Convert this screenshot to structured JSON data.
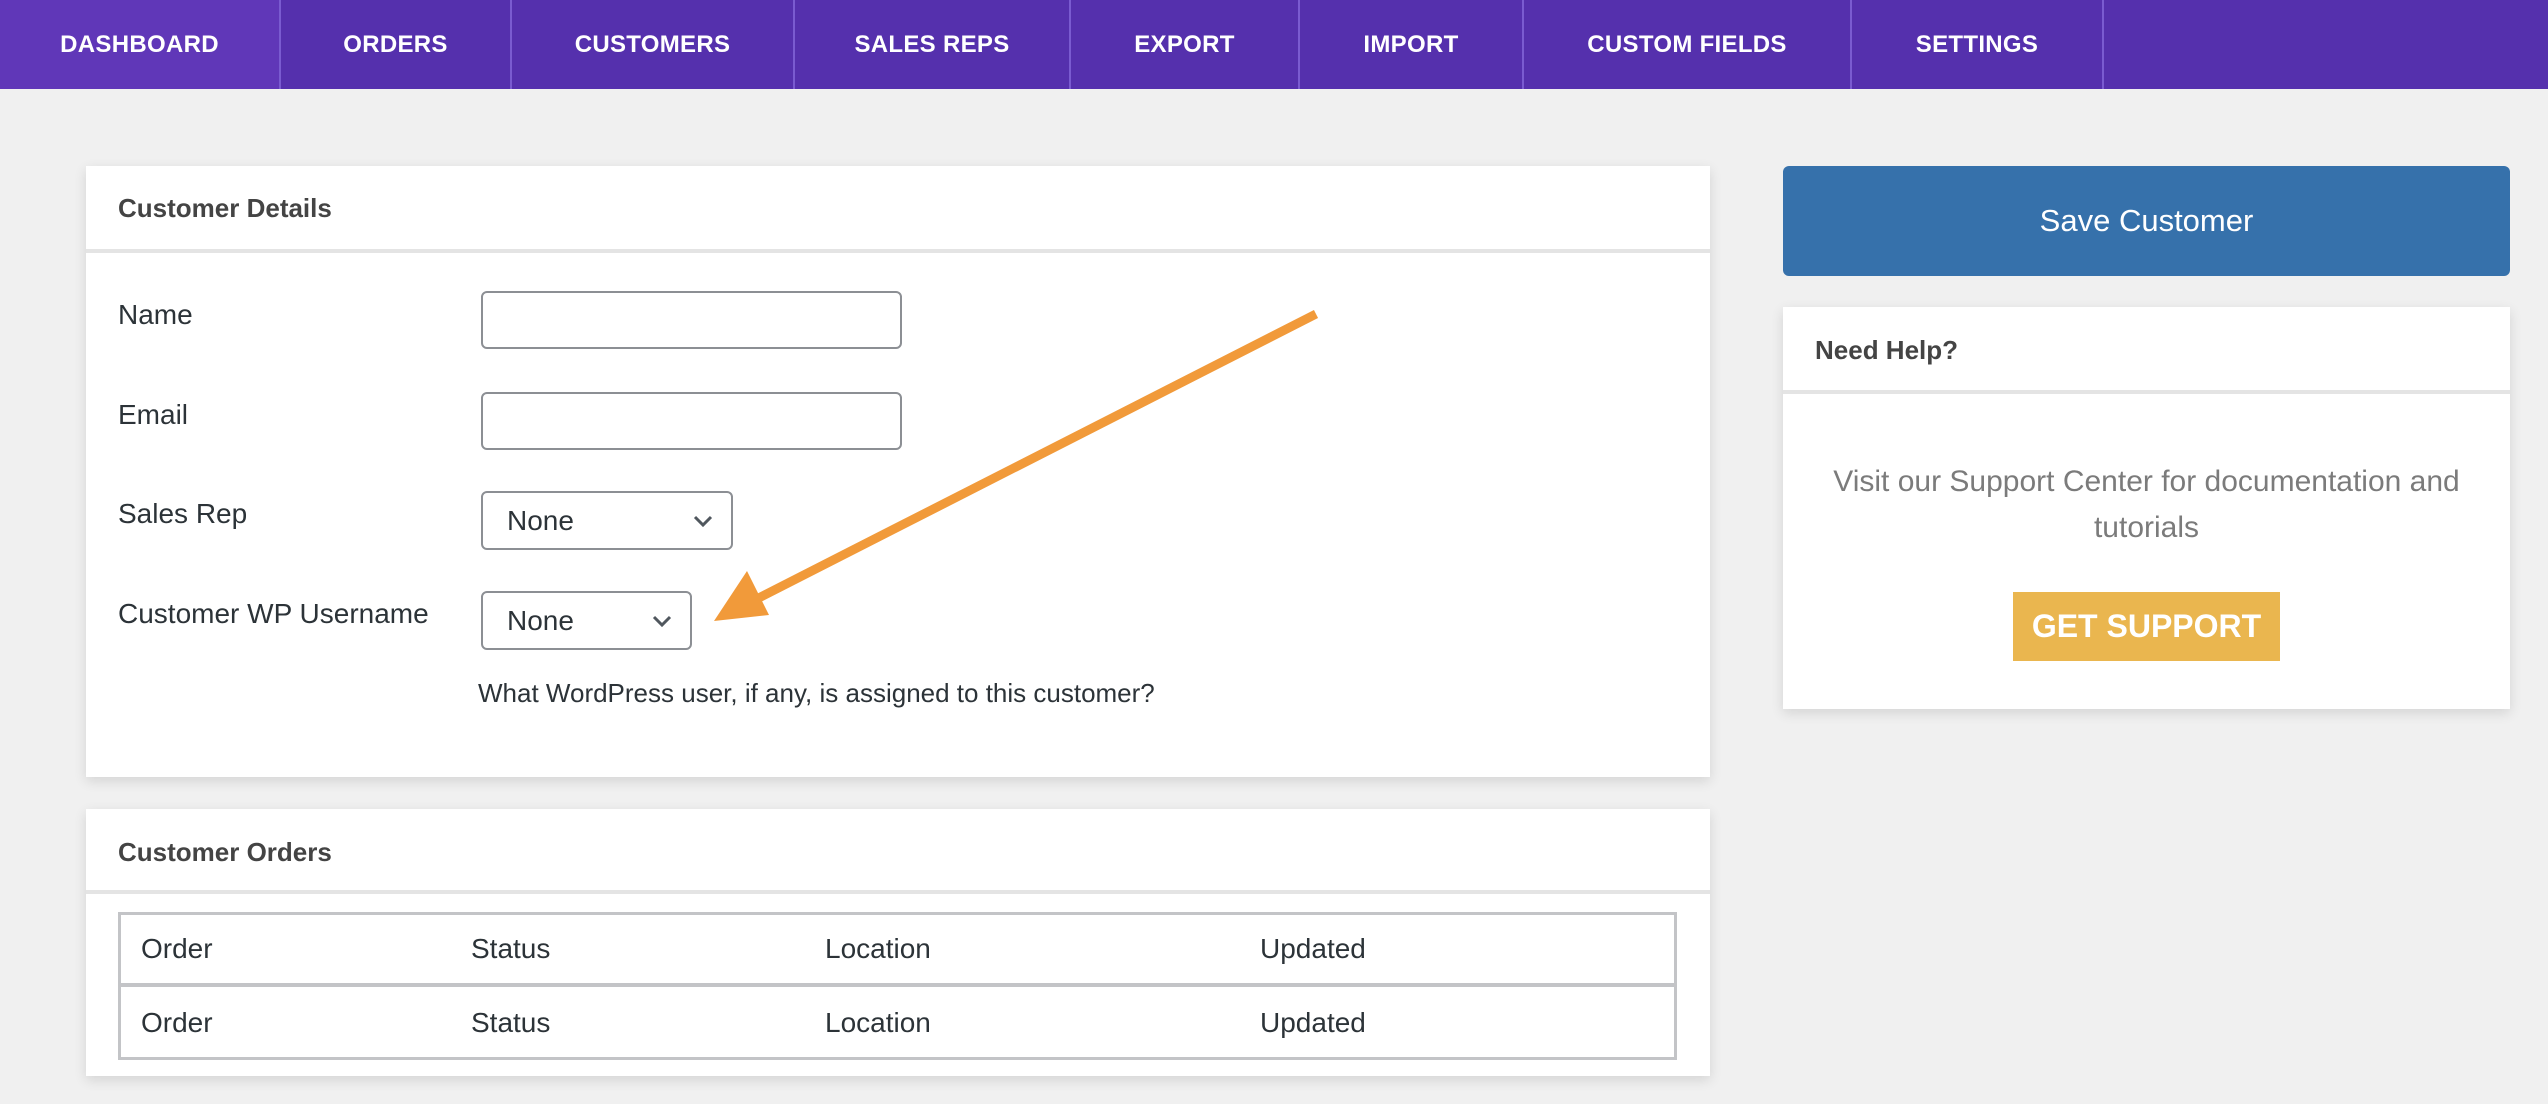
{
  "nav": {
    "items": [
      {
        "label": "DASHBOARD",
        "active": true
      },
      {
        "label": "ORDERS",
        "active": false
      },
      {
        "label": "CUSTOMERS",
        "active": false
      },
      {
        "label": "SALES REPS",
        "active": false
      },
      {
        "label": "EXPORT",
        "active": false
      },
      {
        "label": "IMPORT",
        "active": false
      },
      {
        "label": "CUSTOM FIELDS",
        "active": false
      },
      {
        "label": "SETTINGS",
        "active": false
      }
    ]
  },
  "details": {
    "title": "Customer Details",
    "fields": {
      "name": {
        "label": "Name",
        "value": ""
      },
      "email": {
        "label": "Email",
        "value": ""
      },
      "sales_rep": {
        "label": "Sales Rep",
        "selected": "None"
      },
      "wp_username": {
        "label": "Customer WP Username",
        "selected": "None",
        "help": "What WordPress user, if any, is assigned to this customer?"
      }
    }
  },
  "orders": {
    "title": "Customer Orders",
    "columns": [
      "Order",
      "Status",
      "Location",
      "Updated"
    ],
    "rows": [
      [
        "Order",
        "Status",
        "Location",
        "Updated"
      ]
    ]
  },
  "sidebar": {
    "save_label": "Save Customer",
    "help": {
      "title": "Need Help?",
      "text": "Visit our Support Center for documentation and tutorials",
      "button_label": "GET SUPPORT"
    }
  },
  "annotation": {
    "type": "arrow",
    "points_to": "wp-username-select",
    "color": "#f19a3a"
  },
  "colors": {
    "nav_bg": "#5530ad",
    "save_button": "#3671ab",
    "support_button": "#eab64f"
  }
}
